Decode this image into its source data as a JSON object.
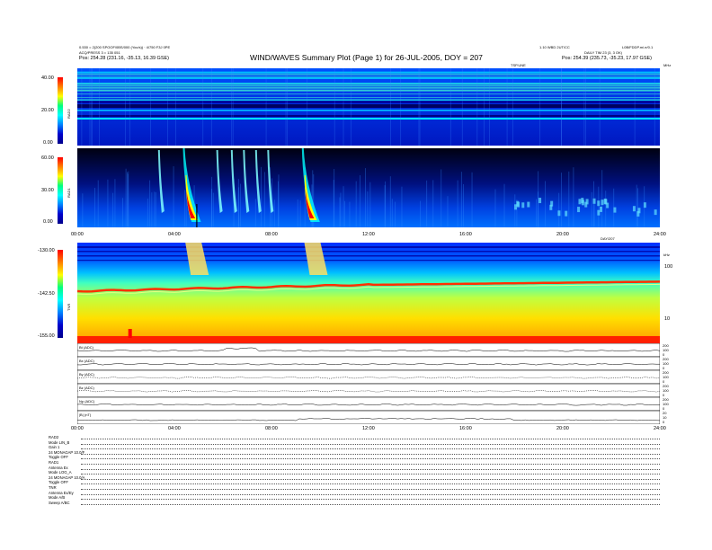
{
  "header": {
    "title": "WIND/WAVES Summary Plot (Page 1) for 26-JUL-2005, DOY = 207",
    "left_line1": "0.530 = 2(200 SPOOF/0BS/000 (Yoc/s)) · 4/750 F3J 0PE",
    "left_line2": "ACQ/PRESS 3 = 135 051",
    "left_line3": "Pos: 254.28 (231.16, -35.13, 16.39 GSE)",
    "right_line1": "1.10 WBD 2UT/CC",
    "right_line2": "DAILY TIM 23 (3, 3 OK)",
    "right_line3": "Pos: 254.39 (235.73, -35.23, 17.97 GSE)",
    "far_right": "L0B/FDDP.m/.e/0.1",
    "unit_mark": "TSP.UNE",
    "mhz_label": "MHz",
    "khz_label": "kHz",
    "day_label": "DAY/207"
  },
  "colors": {
    "background_dark": "#00002a",
    "spectral_low": "#0000cc",
    "spectral_mid": "#00c8ff",
    "spectral_high": "#ffff00",
    "spectral_peak": "#ff0000"
  },
  "chart_data": [
    {
      "type": "heatmap",
      "name": "RAD2",
      "ylabel": "RAD2",
      "colorbar_ticks": [
        "40.00",
        "20.00",
        "0.00"
      ],
      "colorbar_range": [
        0,
        40
      ],
      "x_range_hours": [
        0,
        24
      ],
      "description_features": "uniform blue spectrogram with horizontal bright lines near top"
    },
    {
      "type": "heatmap",
      "name": "RAD1",
      "ylabel": "RAD1",
      "colorbar_ticks": [
        "60.00",
        "30.00",
        "0.00"
      ],
      "colorbar_range": [
        0,
        60
      ],
      "x_range_hours": [
        0,
        24
      ],
      "bursts_hours": [
        3.4,
        4.5,
        5.8,
        6.4,
        6.9,
        7.4,
        7.9,
        9.4
      ],
      "xticks": [
        "00:00",
        "04:00",
        "08:00",
        "12:00",
        "16:00",
        "20:00",
        "24:00"
      ]
    },
    {
      "type": "heatmap",
      "name": "TNR",
      "ylabel": "TNR",
      "colorbar_ticks": [
        "-130.00",
        "-142.50",
        "-155.00"
      ],
      "colorbar_range": [
        -155,
        -130
      ],
      "right_ticks": [
        "100",
        "10"
      ],
      "x_range_hours": [
        0,
        24
      ]
    },
    {
      "type": "line",
      "name": "Field panels",
      "rows": [
        {
          "label": "Bt (ADC)",
          "right_ticks": [
            "200",
            "100",
            "0"
          ]
        },
        {
          "label": "Bx (ADC)",
          "right_ticks": [
            "200",
            "100",
            "0"
          ]
        },
        {
          "label": "By (ADC)",
          "right_ticks": [
            "200",
            "100",
            "0"
          ]
        },
        {
          "label": "Bz (ADC)",
          "right_ticks": [
            "200",
            "100",
            "0"
          ]
        },
        {
          "label": "Np (ADC)",
          "right_ticks": [
            "200",
            "100",
            "0"
          ]
        },
        {
          "label": "|B| (nT)",
          "right_ticks": [
            "20",
            "10",
            "0"
          ]
        }
      ],
      "xticks": [
        "00:00",
        "04:00",
        "08:00",
        "12:00",
        "16:00",
        "20:00",
        "24:00"
      ]
    }
  ],
  "info_block": [
    {
      "label": "RAD2"
    },
    {
      "label": "Mode    LIN_B"
    },
    {
      "label": "Gain       1"
    },
    {
      "label": "24 MONAGAP  10.0/F"
    },
    {
      "label": "Toggle    OFF"
    },
    {
      "label": "RAD1"
    },
    {
      "label": "Antenna    Ex"
    },
    {
      "label": "Mode    LOG_A"
    },
    {
      "label": "24 MONAGAP  10.0/A"
    },
    {
      "label": "Toggle    OFF"
    },
    {
      "label": "TNR"
    },
    {
      "label": "Antenna   Ex/Ey"
    },
    {
      "label": "Mode      A/B"
    },
    {
      "label": "Sweep     A/BC"
    }
  ]
}
